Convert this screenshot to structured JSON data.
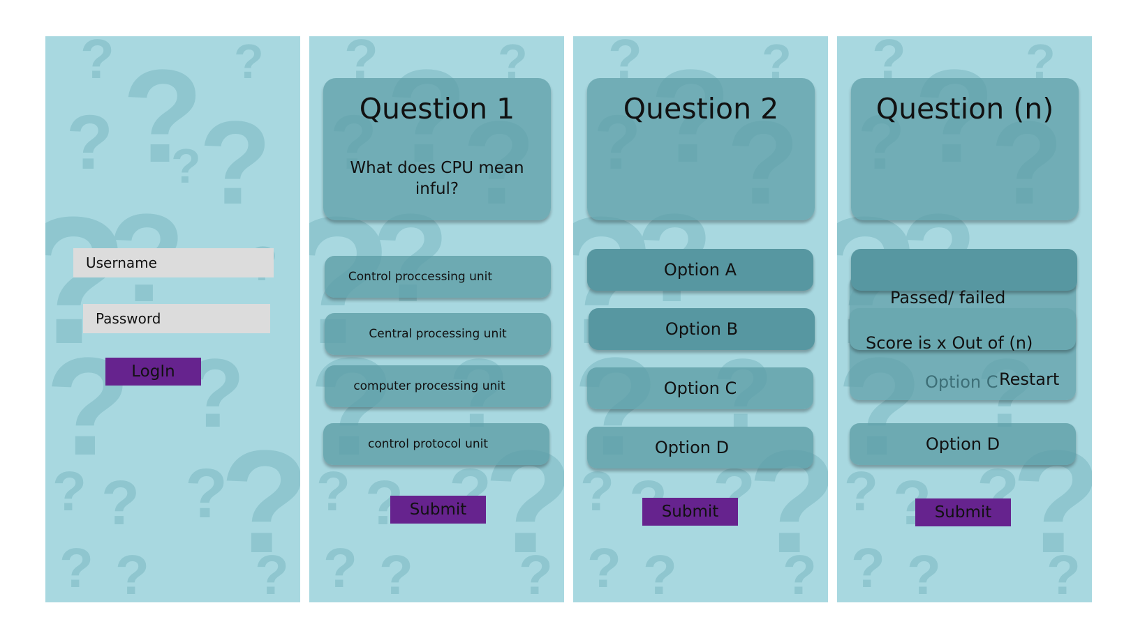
{
  "login": {
    "username_label": "Username",
    "password_label": "Password",
    "login_label": "LogIn"
  },
  "q1": {
    "title": "Question 1",
    "text": "What does CPU mean inful?",
    "options": [
      "Control proccessing unit",
      "Central processing unit",
      "computer processing unit",
      "control  protocol unit"
    ],
    "submit_label": "Submit"
  },
  "q2": {
    "title": "Question 2",
    "options": [
      "Option A",
      "Option B",
      "Option C",
      "Option D"
    ],
    "submit_label": "Submit"
  },
  "qn": {
    "title": "Question (n)",
    "result_label": "Passed/ failed",
    "score_label": "Score is x Out of (n)",
    "option_c_label": "Option C",
    "restart_label": "Restart",
    "option_d_label": "Option D",
    "submit_label": "Submit"
  },
  "colors": {
    "screen_bg": "#a8d8e0",
    "card": "#5c9ca5",
    "button": "#66238e",
    "field": "#dcdcdc"
  }
}
